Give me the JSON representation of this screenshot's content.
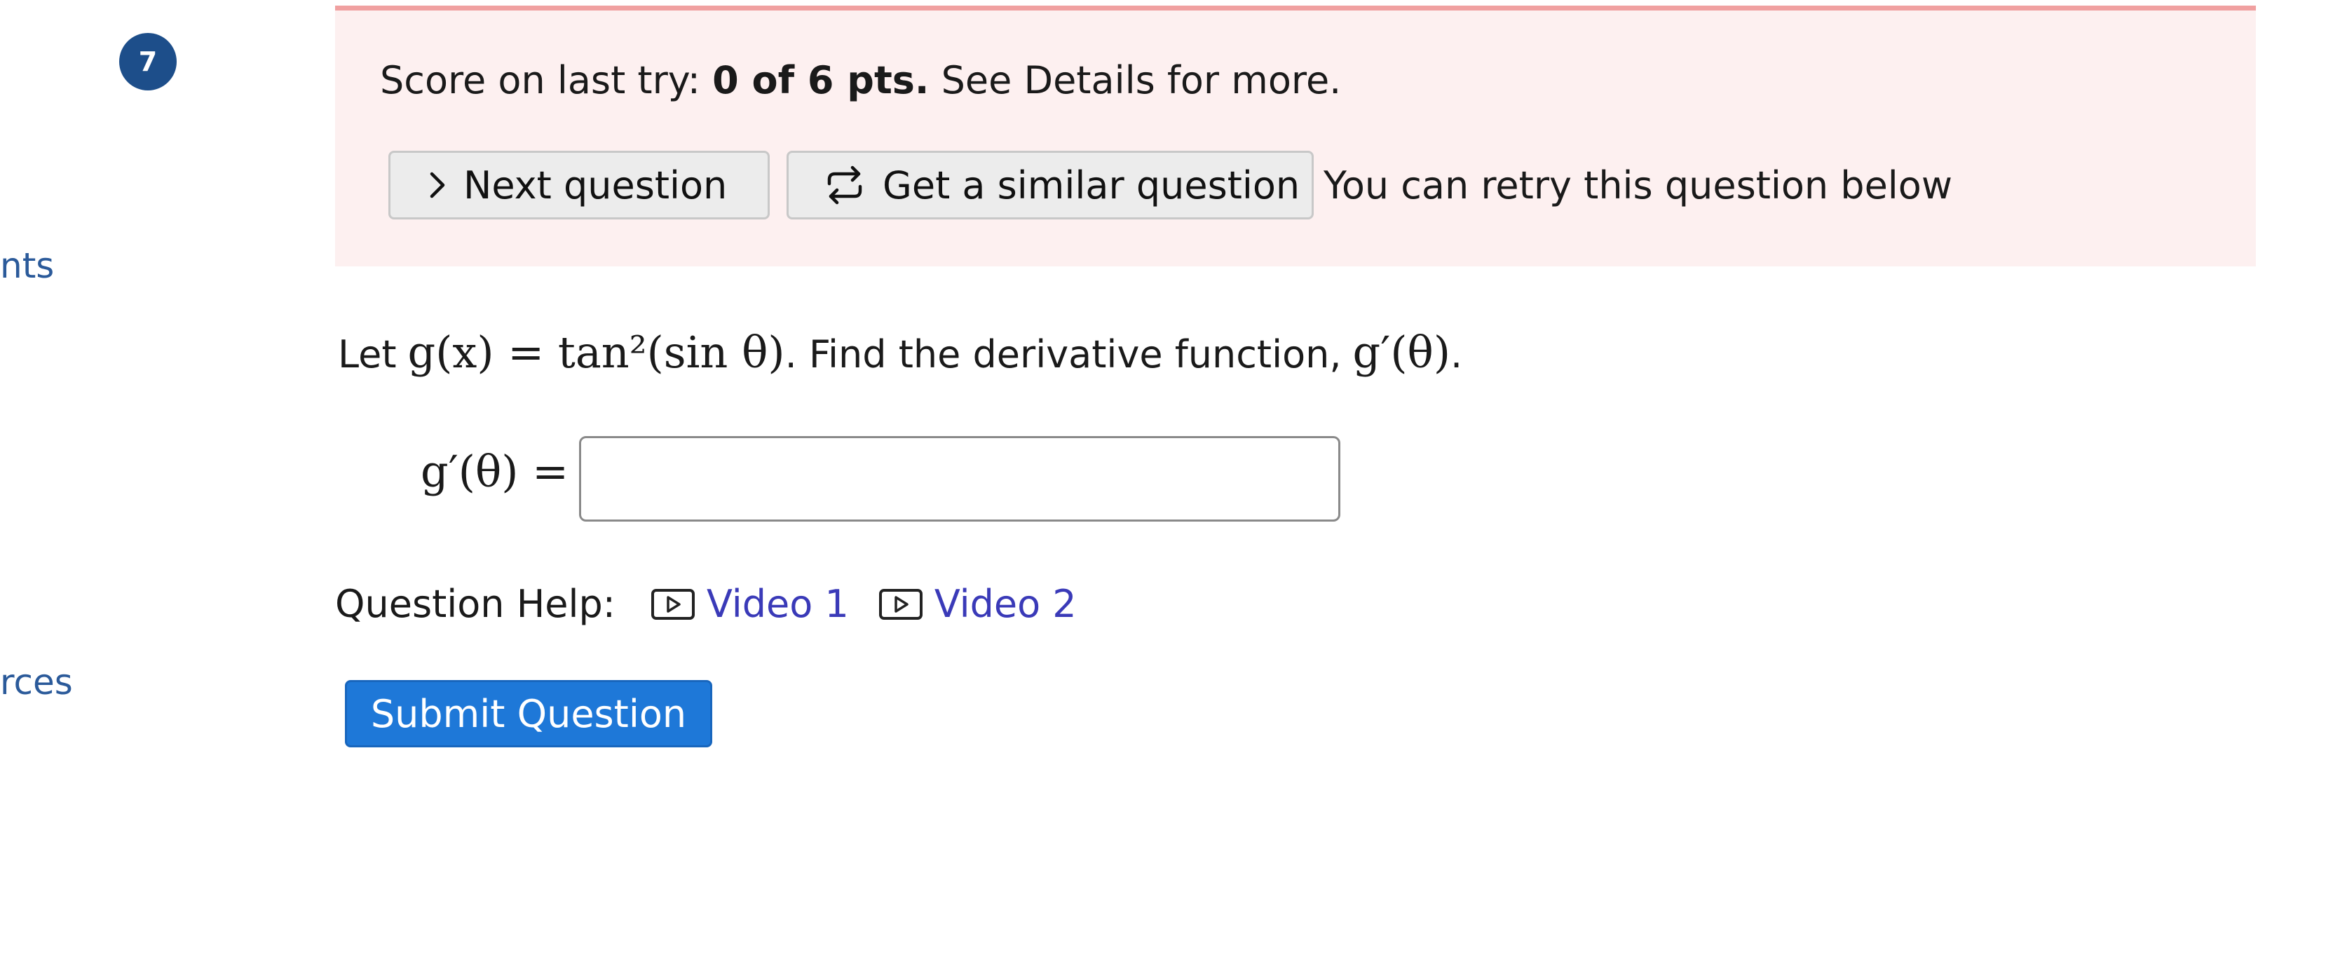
{
  "sidebar": {
    "links": [
      "nts",
      "rces"
    ]
  },
  "question_number": "7",
  "banner": {
    "score_prefix": "Score on last try:",
    "score_value": "0 of 6 pts.",
    "score_suffix": "See Details for more.",
    "next_label": "Next question",
    "similar_label": "Get a similar question",
    "retry_text": "You can retry this question below"
  },
  "problem": {
    "lead": "Let",
    "function_def": "g(x) = tan²(sin θ)",
    "mid": ". Find the derivative function,",
    "target": "g′(θ)",
    "end": "."
  },
  "answer": {
    "label": "g′(θ) =",
    "value": "",
    "placeholder": ""
  },
  "help": {
    "label": "Question Help:",
    "videos": [
      "Video 1",
      "Video 2"
    ]
  },
  "submit_label": "Submit Question",
  "colors": {
    "banner_bg": "#fdf0f0",
    "banner_border": "#f0a0a0",
    "submit_bg": "#1e78d8",
    "link": "#3a3ab8",
    "badge": "#1d4e8a"
  },
  "icons": {
    "next": "chevron-right-icon",
    "similar": "repeat-arrows-icon",
    "video": "video-play-icon"
  }
}
